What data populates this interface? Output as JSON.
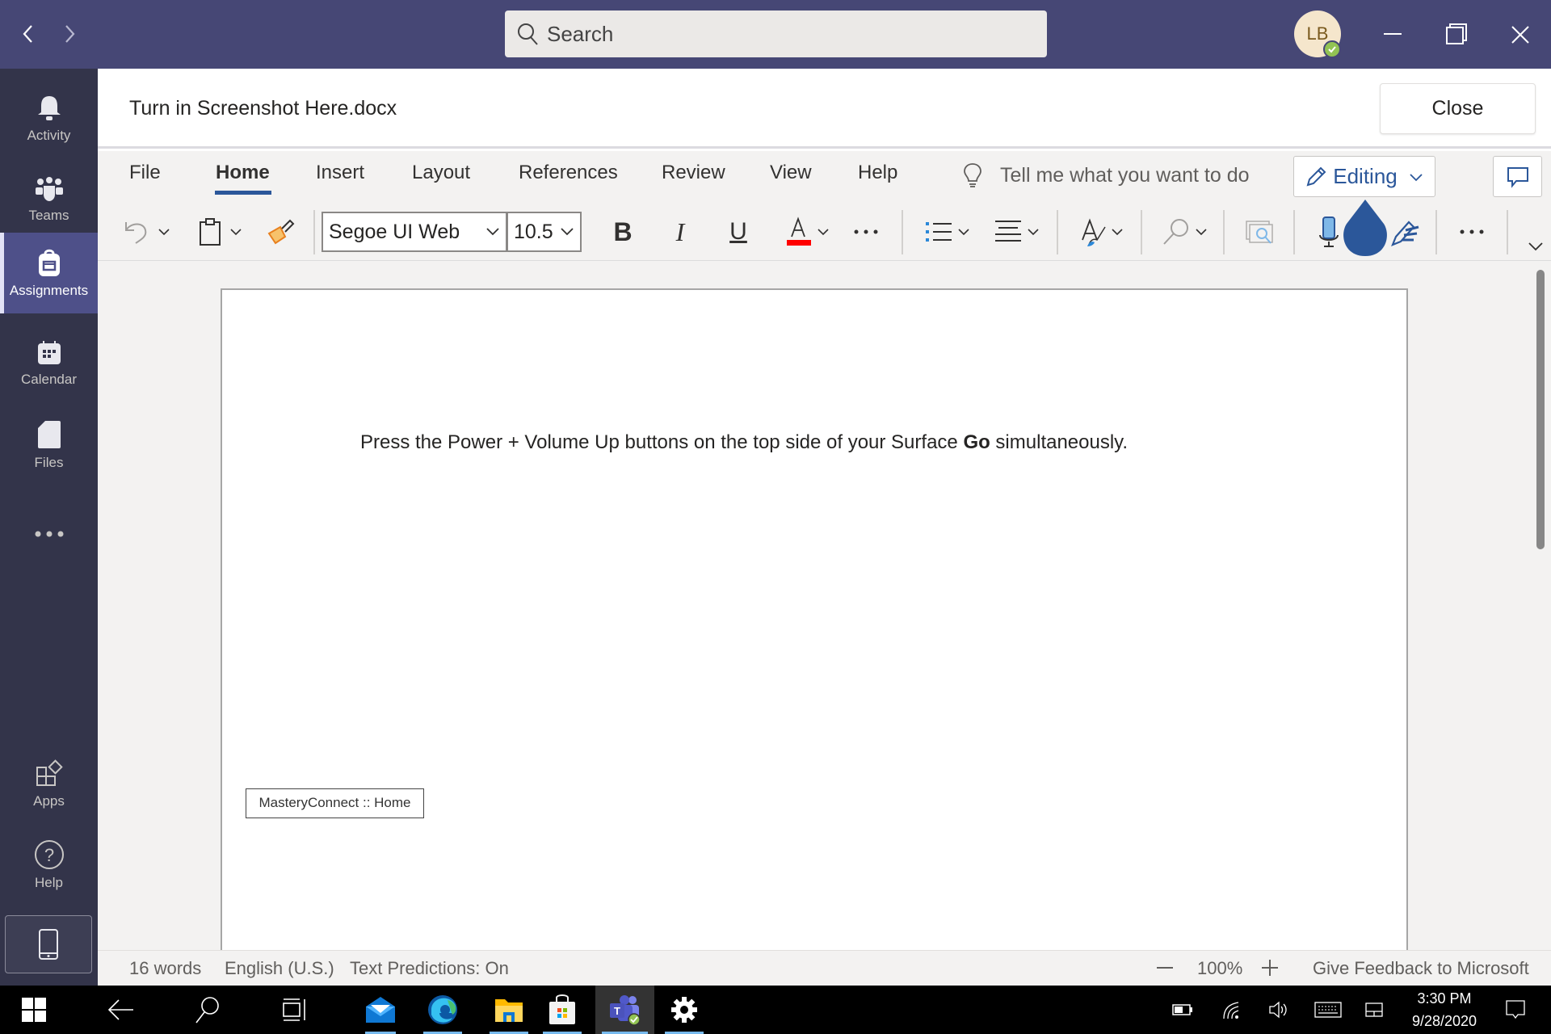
{
  "titlebar": {
    "back_icon": "chevron-left-icon",
    "forward_icon": "chevron-right-icon",
    "search_placeholder": "Search",
    "avatar_initials": "LB",
    "presence": "available",
    "colors": {
      "titlebar": "#464775",
      "rail": "#33344a",
      "rail_active": "#4e5089"
    }
  },
  "rail": {
    "items": [
      {
        "label": "Activity",
        "icon": "bell-icon",
        "active": false
      },
      {
        "label": "Teams",
        "icon": "teams-icon",
        "active": false
      },
      {
        "label": "Assignments",
        "icon": "backpack-icon",
        "active": true
      },
      {
        "label": "Calendar",
        "icon": "calendar-icon",
        "active": false
      },
      {
        "label": "Files",
        "icon": "file-icon",
        "active": false
      }
    ],
    "more_icon": "more-horizontal-icon",
    "bottom": [
      {
        "label": "Apps",
        "icon": "apps-icon"
      },
      {
        "label": "Help",
        "icon": "help-icon"
      }
    ],
    "device_icon": "mobile-device-icon"
  },
  "document": {
    "filename": "Turn in Screenshot Here.docx",
    "close_label": "Close",
    "body_before": "Press the Power + Volume Up buttons on the top side of your Surface ",
    "body_bold": "Go",
    "body_after": " simultaneously.",
    "link_box": "MasteryConnect :: Home"
  },
  "ribbon": {
    "tabs": [
      {
        "label": "File",
        "active": false
      },
      {
        "label": "Home",
        "active": true
      },
      {
        "label": "Insert",
        "active": false
      },
      {
        "label": "Layout",
        "active": false
      },
      {
        "label": "References",
        "active": false
      },
      {
        "label": "Review",
        "active": false
      },
      {
        "label": "View",
        "active": false
      },
      {
        "label": "Help",
        "active": false
      }
    ],
    "tell_me": "Tell me what you want to do",
    "mode_label": "Editing",
    "font_name": "Segoe UI Web",
    "font_size": "10.5",
    "font_color": "#ff0000",
    "accent": "#2b579a"
  },
  "statusbar": {
    "word_count": "16 words",
    "language": "English (U.S.)",
    "text_predictions": "Text Predictions: On",
    "zoom": "100%",
    "feedback": "Give Feedback to Microsoft"
  },
  "taskbar": {
    "apps": [
      "Mail",
      "Microsoft Edge",
      "File Explorer",
      "Microsoft Store",
      "Microsoft Teams",
      "Settings"
    ],
    "time": "3:30 PM",
    "date": "9/28/2020"
  }
}
